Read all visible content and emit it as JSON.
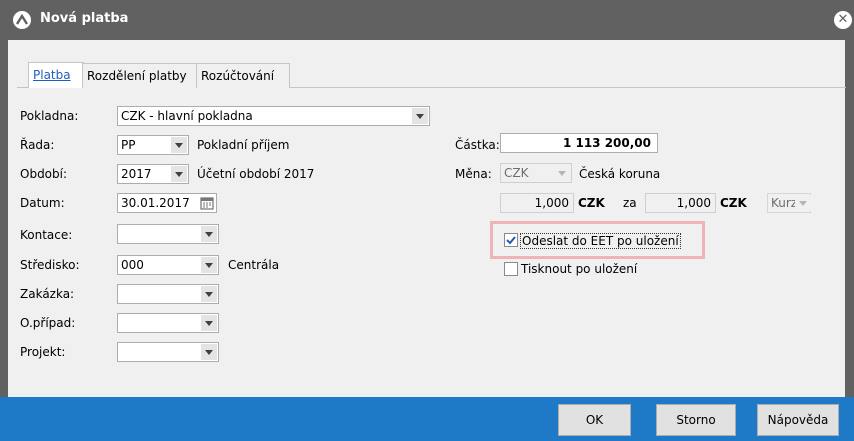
{
  "window": {
    "title": "Nová platba"
  },
  "tabs": [
    {
      "label": "Platba",
      "active": true
    },
    {
      "label": "Rozdělení platby"
    },
    {
      "label": "Rozúčtování"
    }
  ],
  "form": {
    "pokladna": {
      "label": "Pokladna:",
      "value": "CZK - hlavní pokladna"
    },
    "rada": {
      "label": "Řada:",
      "value": "PP",
      "desc": "Pokladní příjem"
    },
    "obdobi": {
      "label": "Období:",
      "value": "2017",
      "desc": "Účetní období 2017"
    },
    "datum": {
      "label": "Datum:",
      "value": "30.01.2017"
    },
    "kontace": {
      "label": "Kontace:",
      "value": ""
    },
    "stredisko": {
      "label": "Středisko:",
      "value": "000",
      "desc": "Centrála"
    },
    "zakazka": {
      "label": "Zakázka:",
      "value": ""
    },
    "opripad": {
      "label": "O.případ:",
      "value": ""
    },
    "projekt": {
      "label": "Projekt:",
      "value": ""
    }
  },
  "amount": {
    "castka_label": "Částka:",
    "castka_value": "1 113 200,00",
    "mena_label": "Měna:",
    "mena_value": "CZK",
    "mena_desc": "Česká koruna",
    "rate_left": "1,000",
    "rate_left_cur": "CZK",
    "rate_za": "za",
    "rate_right": "1,000",
    "rate_right_cur": "CZK",
    "kurz_label": "Kurz"
  },
  "options": {
    "eet_label": "Odeslat do EET po uložení",
    "eet_checked": true,
    "print_label": "Tisknout po uložení",
    "print_checked": false
  },
  "buttons": {
    "ok": "OK",
    "storno": "Storno",
    "napoveda": "Nápověda"
  },
  "colors": {
    "titlebar": "#616161",
    "bottombar": "#1e7ac7",
    "highlight": "#f2b3b8",
    "check": "#1a5fb4"
  }
}
